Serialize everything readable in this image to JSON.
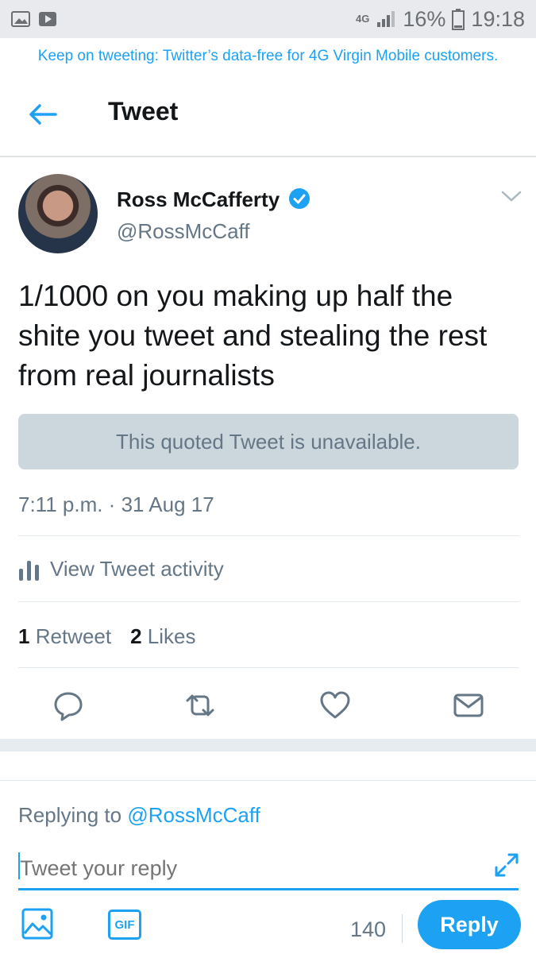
{
  "status_bar": {
    "network": "4G",
    "battery": "16%",
    "time": "19:18"
  },
  "promo_banner": "Keep on tweeting: Twitter’s data-free for 4G Virgin Mobile customers.",
  "header": {
    "title": "Tweet"
  },
  "tweet": {
    "author_name": "Ross McCafferty",
    "handle": "@RossMcCaff",
    "text": "1/1000 on you making up half the shite you tweet and stealing the rest from real journalists",
    "quoted_unavailable": "This quoted Tweet is unavailable.",
    "timestamp": "7:11 p.m. · 31 Aug 17",
    "activity_label": "View Tweet activity",
    "retweet_count": "1",
    "retweet_label": "Retweet",
    "like_count": "2",
    "like_label": "Likes"
  },
  "reply": {
    "replying_prefix": "Replying to ",
    "replying_to": "@RossMcCaff",
    "placeholder": "Tweet your reply",
    "gif_label": "GIF",
    "char_count": "140",
    "button_label": "Reply"
  },
  "colors": {
    "accent": "#1da1f2",
    "secondary_text": "#657786",
    "quote_bg": "#ccd6dd"
  },
  "icons": [
    "gallery-icon",
    "video-icon",
    "signal-icon",
    "battery-icon",
    "back-arrow-icon",
    "verified-badge-icon",
    "chevron-down-icon",
    "activity-chart-icon",
    "reply-icon",
    "retweet-icon",
    "like-icon",
    "direct-message-icon",
    "expand-icon",
    "image-icon"
  ]
}
